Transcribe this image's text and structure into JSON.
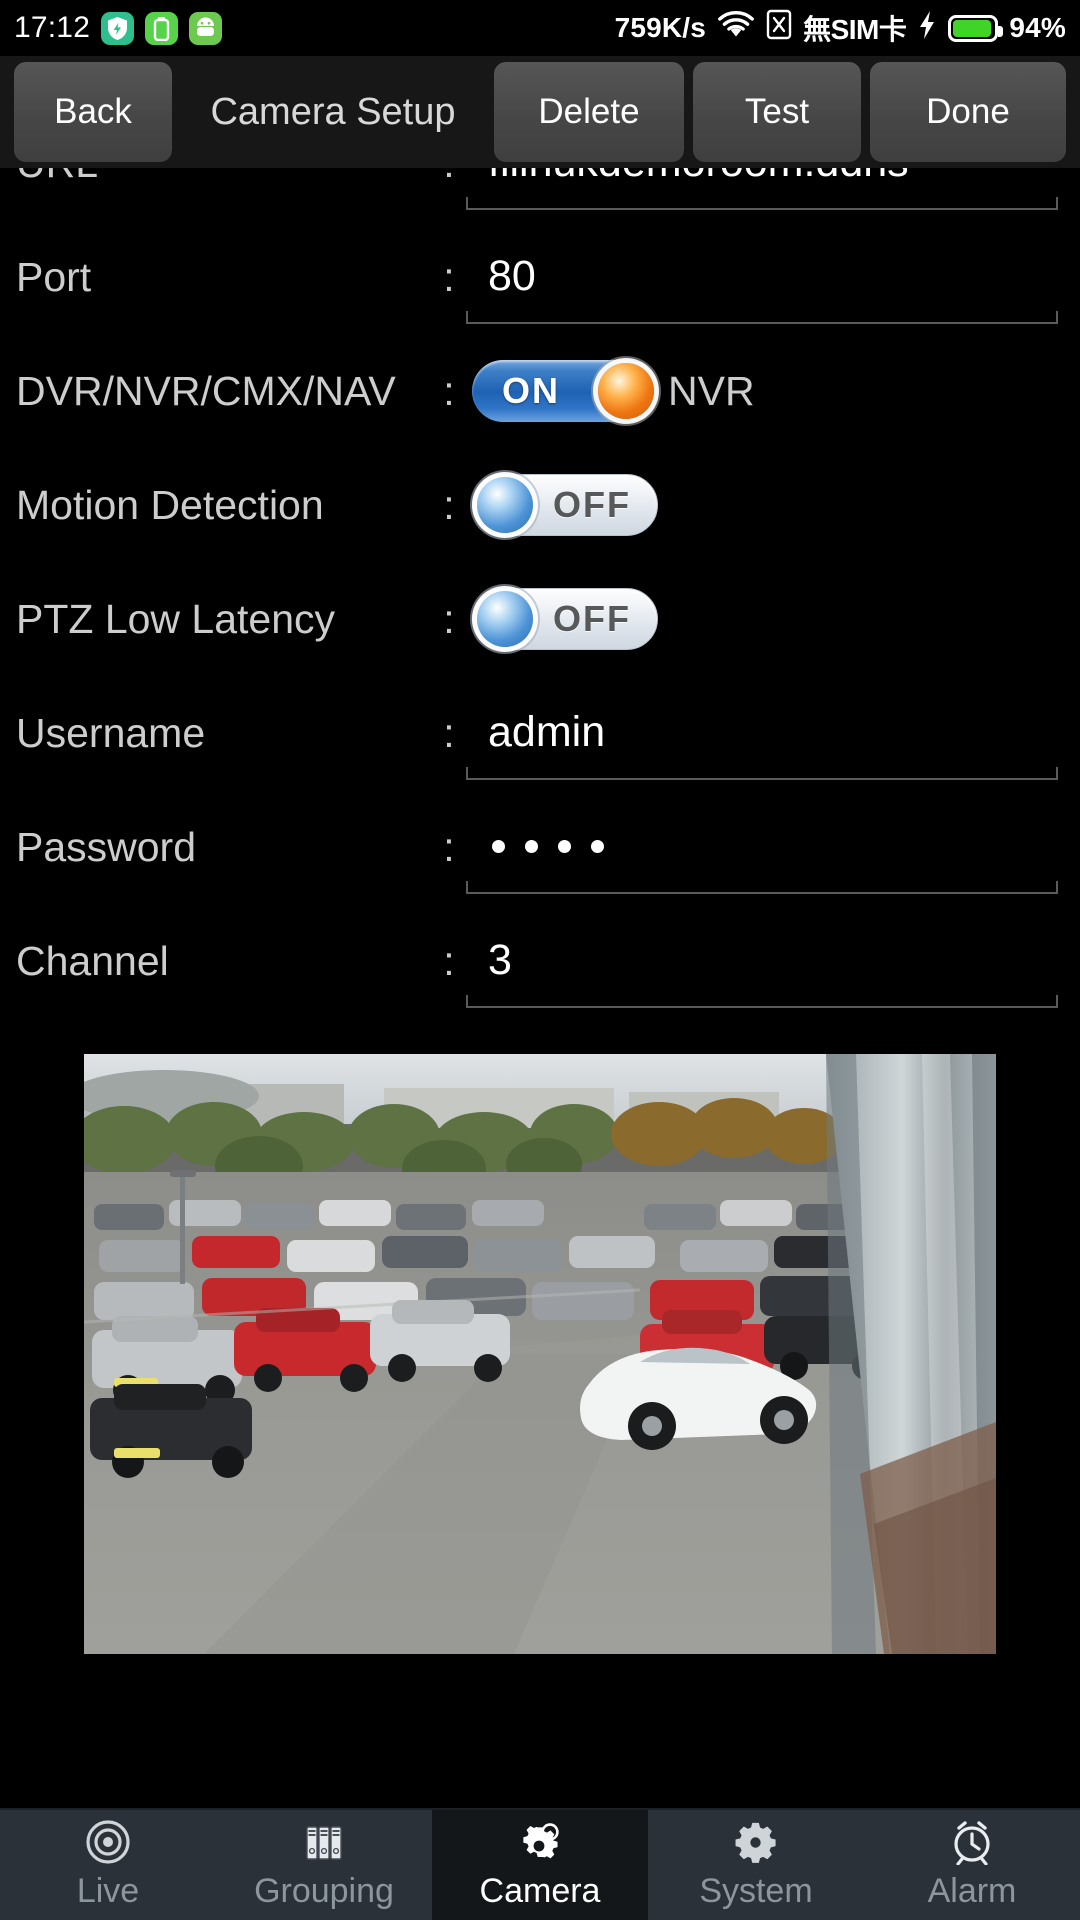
{
  "status_bar": {
    "time": "17:12",
    "app_icons": [
      "shield-bolt-icon",
      "battery-app-icon",
      "android-robot-icon"
    ],
    "network_speed": "759K/s",
    "wifi": "wifi-icon",
    "sim_slot": "sim-x-icon",
    "no_sim_text": "無SIM卡",
    "charging": "charging-bolt-icon",
    "battery_percent": "94%",
    "battery_level": 94,
    "accent_green": "#3fd427"
  },
  "toolbar": {
    "back_label": "Back",
    "title": "Camera Setup",
    "delete_label": "Delete",
    "test_label": "Test",
    "done_label": "Done"
  },
  "form": {
    "colon": ":",
    "rows": [
      {
        "label": "URL",
        "value": "fiiinukdemoroom.ddns"
      },
      {
        "label": "Port",
        "value": "80"
      },
      {
        "label": "DVR/NVR/CMX/NAV",
        "toggle": "ON",
        "suffix": "NVR"
      },
      {
        "label": "Motion Detection",
        "toggle": "OFF"
      },
      {
        "label": "PTZ Low Latency",
        "toggle": "OFF"
      },
      {
        "label": "Username",
        "value": "admin"
      },
      {
        "label": "Password",
        "value": "••••",
        "masked_count": 4
      },
      {
        "label": "Channel",
        "value": "3"
      }
    ]
  },
  "preview": {
    "description": "car-park-camera-preview"
  },
  "bottom_nav": {
    "items": [
      {
        "label": "Live",
        "icon": "target-icon",
        "active": false
      },
      {
        "label": "Grouping",
        "icon": "folders-icon",
        "active": false
      },
      {
        "label": "Camera",
        "icon": "gear-camera-icon",
        "active": true
      },
      {
        "label": "System",
        "icon": "gear-icon",
        "active": false
      },
      {
        "label": "Alarm",
        "icon": "alarm-clock-icon",
        "active": false
      }
    ]
  }
}
